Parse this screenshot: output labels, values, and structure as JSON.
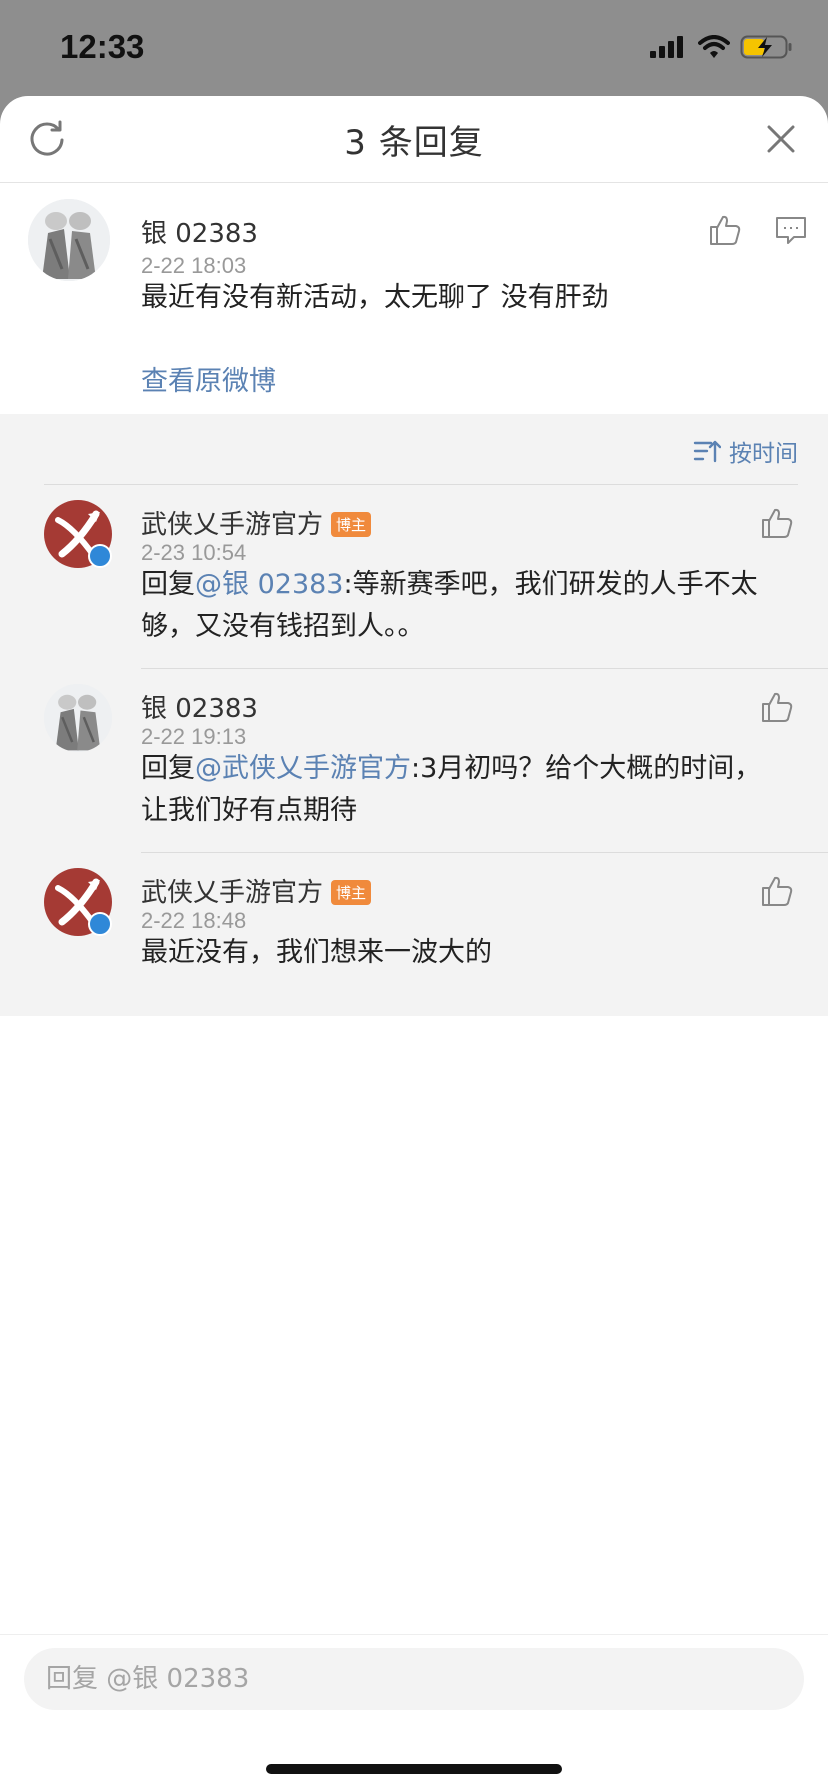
{
  "status_bar": {
    "time": "12:33"
  },
  "sheet": {
    "title": "3 条回复"
  },
  "root_comment": {
    "user": "银 02383",
    "time": "2-22 18:03",
    "text": "最近有没有新活动，太无聊了  没有肝劲",
    "view_original": "查看原微博"
  },
  "sort": {
    "label": "按时间"
  },
  "replies": [
    {
      "user": "武侠乂手游官方",
      "badge": "博主",
      "time": "2-23 10:54",
      "prefix": "回复",
      "mention": "@银 02383",
      "text": ":等新赛季吧，我们研发的人手不太够，又没有钱招到人。。"
    },
    {
      "user": "银 02383",
      "time": "2-22 19:13",
      "prefix": "回复",
      "mention": "@武侠乂手游官方",
      "text": ":3月初吗？给个大概的时间，让我们好有点期待"
    },
    {
      "user": "武侠乂手游官方",
      "badge": "博主",
      "time": "2-22 18:48",
      "text": "最近没有，我们想来一波大的"
    }
  ],
  "reply_input": {
    "placeholder": "回复 @银 02383"
  },
  "colors": {
    "link": "#5b82b3",
    "brand": "#a53a34",
    "badge": "#f08a3c"
  }
}
